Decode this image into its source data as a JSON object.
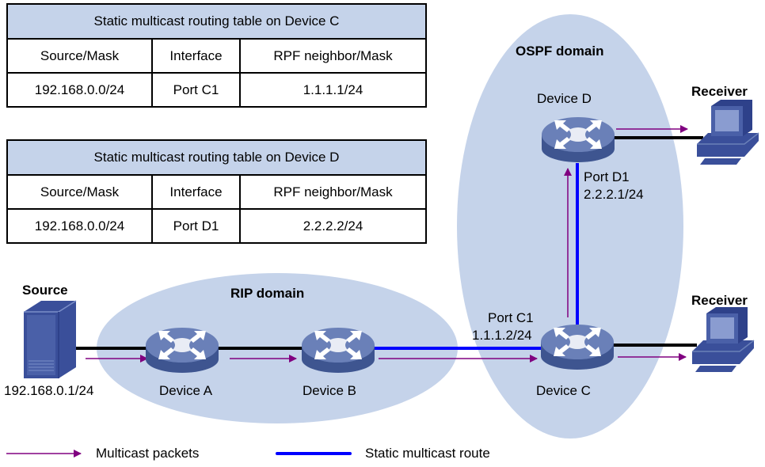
{
  "tables": [
    {
      "title": "Static multicast routing table on Device C",
      "headers": [
        "Source/Mask",
        "Interface",
        "RPF neighbor/Mask"
      ],
      "row": [
        "192.168.0.0/24",
        "Port C1",
        "1.1.1.1/24"
      ]
    },
    {
      "title": "Static multicast routing table on Device D",
      "headers": [
        "Source/Mask",
        "Interface",
        "RPF neighbor/Mask"
      ],
      "row": [
        "192.168.0.0/24",
        "Port D1",
        "2.2.2.2/24"
      ]
    }
  ],
  "domains": {
    "rip": "RIP domain",
    "ospf": "OSPF domain"
  },
  "nodes": {
    "source": {
      "label": "Source",
      "ip": "192.168.0.1/24"
    },
    "device_a": "Device A",
    "device_b": "Device B",
    "device_c": "Device C",
    "device_d": "Device D",
    "receiver_top": "Receiver",
    "receiver_bottom": "Receiver"
  },
  "ports": {
    "c1": {
      "name": "Port C1",
      "ip": "1.1.1.2/24"
    },
    "d1": {
      "name": "Port D1",
      "ip": "2.2.2.1/24"
    }
  },
  "legend": {
    "multicast_packets": "Multicast packets",
    "static_route": "Static multicast route"
  },
  "colors": {
    "domain_fill": "#c5d3ea",
    "table_header": "#c5d3ea",
    "static_route": "#0000ff",
    "multicast_arrow": "#800080",
    "link": "#000000",
    "router_top": "#6a80b8",
    "router_side": "#3e5590",
    "device_blue": "#3a4f9a"
  }
}
